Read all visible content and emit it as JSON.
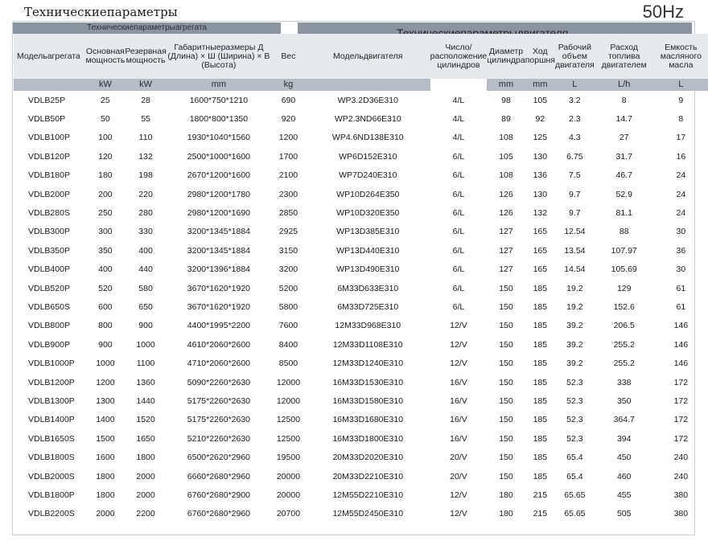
{
  "page": {
    "title": "Техническиепараметры",
    "frequency": "50Hz",
    "genset_section_title": "Техническиепараметрыагрегата",
    "engine_section_title": "Техническиепараметрыдвигателя"
  },
  "headers": [
    {
      "label": "Модельагрегата",
      "unit": ""
    },
    {
      "label": "Основная мощность",
      "unit": "kW"
    },
    {
      "label": "Резервная мощность",
      "unit": "kW"
    },
    {
      "label": "Габаритныеразмеры Д (Длина) × Ш (Ширина) × В (Высота)",
      "unit": "mm"
    },
    {
      "label": "Вес",
      "unit": "kg"
    },
    {
      "label": "Модельдвигателя",
      "unit": ""
    },
    {
      "label": "Число/расположение цилиндров",
      "unit": ""
    },
    {
      "label": "Диаметр цилиндра",
      "unit": "mm"
    },
    {
      "label": "Ход поршня",
      "unit": "mm"
    },
    {
      "label": "Рабочий объем двигателя",
      "unit": "L"
    },
    {
      "label": "Расход топлива двигателем",
      "unit": "L/h"
    },
    {
      "label": "Емкость масляного масла",
      "unit": "L"
    }
  ],
  "rows": [
    [
      "VDLB25P",
      "25",
      "28",
      "1600*750*1210",
      "690",
      "WP3.2D36E310",
      "4/L",
      "98",
      "105",
      "3.2",
      "8",
      "9"
    ],
    [
      "VDLB50P",
      "50",
      "55",
      "1800*800*1350",
      "920",
      "WP2.3ND66E310",
      "4/L",
      "89",
      "92",
      "2.3",
      "14.7",
      "8"
    ],
    [
      "VDLB100P",
      "100",
      "110",
      "1930*1040*1560",
      "1200",
      "WP4.6ND138E310",
      "4/L",
      "108",
      "125",
      "4.3",
      "27",
      "17"
    ],
    [
      "VDLB120P",
      "120",
      "132",
      "2500*1000*1600",
      "1700",
      "WP6D152E310",
      "6/L",
      "105",
      "130",
      "6.75",
      "31.7",
      "16"
    ],
    [
      "VDLB180P",
      "180",
      "198",
      "2670*1200*1600",
      "2100",
      "WP7D240E310",
      "6/L",
      "108",
      "136",
      "7.5",
      "46.7",
      "24"
    ],
    [
      "VDLB200P",
      "200",
      "220",
      "2980*1200*1780",
      "2300",
      "WP10D264E350",
      "6/L",
      "126",
      "130",
      "9.7",
      "52.9",
      "24"
    ],
    [
      "VDLB280S",
      "250",
      "280",
      "2980*1200*1690",
      "2850",
      "WP10D320E350",
      "6/L",
      "126",
      "132",
      "9.7",
      "81.1",
      "24"
    ],
    [
      "VDLB300P",
      "300",
      "330",
      "3200*1345*1884",
      "2925",
      "WP13D385E310",
      "6/L",
      "127",
      "165",
      "12.54",
      "88",
      "30"
    ],
    [
      "VDLB350P",
      "350",
      "400",
      "3200*1345*1884",
      "3150",
      "WP13D440E310",
      "6/L",
      "127",
      "165",
      "13.54",
      "107.97",
      "36"
    ],
    [
      "VDLB400P",
      "400",
      "440",
      "3200*1396*1884",
      "3200",
      "WP13D490E310",
      "6/L",
      "127",
      "165",
      "14.54",
      "105.69",
      "30"
    ],
    [
      "VDLB520P",
      "520",
      "580",
      "3670*1620*1920",
      "5200",
      "6M33D633E310",
      "6/L",
      "150",
      "185",
      "19.2",
      "129",
      "61"
    ],
    [
      "VDLB650S",
      "600",
      "650",
      "3670*1620*1920",
      "5800",
      "6M33D725E310",
      "6/L",
      "150",
      "185",
      "19.2",
      "152.6",
      "61"
    ],
    [
      "VDLB800P",
      "800",
      "900",
      "4400*1995*2200",
      "7600",
      "12M33D968E310",
      "12/V",
      "150",
      "185",
      "39.2",
      "206.5",
      "146"
    ],
    [
      "VDLB900P",
      "900",
      "1000",
      "4610*2060*2600",
      "8400",
      "12M33D1108E310",
      "12/V",
      "150",
      "185",
      "39.2",
      "255.2",
      "146"
    ],
    [
      "VDLB1000P",
      "1000",
      "1100",
      "4710*2060*2600",
      "8500",
      "12M33D1240E310",
      "12/V",
      "150",
      "185",
      "39.2",
      "255.2",
      "146"
    ],
    [
      "VDLB1200P",
      "1200",
      "1360",
      "5090*2260*2630",
      "12000",
      "16M33D1530E310",
      "16/V",
      "150",
      "185",
      "52.3",
      "338",
      "172"
    ],
    [
      "VDLB1300P",
      "1300",
      "1440",
      "5175*2260*2630",
      "12000",
      "16M33D1580E310",
      "16/V",
      "150",
      "185",
      "52.3",
      "350",
      "172"
    ],
    [
      "VDLB1400P",
      "1400",
      "1520",
      "5175*2260*2630",
      "12500",
      "16M33D1680E310",
      "16/V",
      "150",
      "185",
      "52.3",
      "364.7",
      "172"
    ],
    [
      "VDLB1650S",
      "1500",
      "1650",
      "5210*2260*2630",
      "12500",
      "16M33D1800E310",
      "16/V",
      "150",
      "185",
      "52.3",
      "394",
      "172"
    ],
    [
      "VDLB1800S",
      "1600",
      "1800",
      "6500*2620*2960",
      "19500",
      "20M33D2020E310",
      "20/V",
      "150",
      "185",
      "65.4",
      "450",
      "240"
    ],
    [
      "VDLB2000S",
      "1800",
      "2000",
      "6660*2680*2960",
      "20000",
      "20M33D2210E310",
      "20/V",
      "150",
      "185",
      "65.4",
      "460",
      "240"
    ],
    [
      "VDLB1800P",
      "1800",
      "2000",
      "6760*2680*2900",
      "20000",
      "12M55D2210E310",
      "12/V",
      "180",
      "215",
      "65.65",
      "455",
      "380"
    ],
    [
      "VDLB2200S",
      "2000",
      "2200",
      "6760*2680*2960",
      "20700",
      "12M55D2450E310",
      "12/V",
      "180",
      "215",
      "65.65",
      "505",
      "380"
    ]
  ]
}
